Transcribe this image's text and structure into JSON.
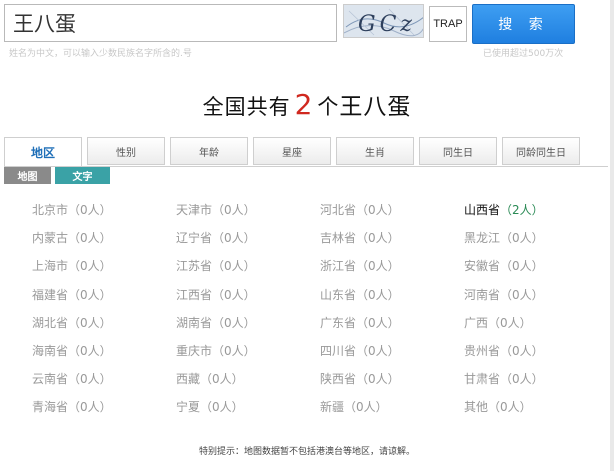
{
  "search": {
    "value": "王八蛋",
    "captcha_text": "GCz",
    "trap_label": "TRAP",
    "button_label": "搜 索"
  },
  "hints": {
    "left": "姓名为中文，可以输入少数民族名字所含的.号",
    "right": "已使用超过500万次"
  },
  "headline": {
    "prefix": "全国共有",
    "count": "2",
    "measure": "个",
    "name": "王八蛋"
  },
  "tabs": [
    {
      "label": "地区",
      "active": true
    },
    {
      "label": "性别"
    },
    {
      "label": "年龄"
    },
    {
      "label": "星座"
    },
    {
      "label": "生肖"
    },
    {
      "label": "同生日"
    },
    {
      "label": "同龄同生日"
    }
  ],
  "view_toggle": {
    "map": "地图",
    "text": "文字"
  },
  "regions": [
    [
      {
        "name": "北京市",
        "count": "（0人）"
      },
      {
        "name": "天津市",
        "count": "（0人）"
      },
      {
        "name": "河北省",
        "count": "（0人）"
      },
      {
        "name": "山西省",
        "count": "（2人）",
        "highlight": true
      }
    ],
    [
      {
        "name": "内蒙古",
        "count": "（0人）"
      },
      {
        "name": "辽宁省",
        "count": "（0人）"
      },
      {
        "name": "吉林省",
        "count": "（0人）"
      },
      {
        "name": "黑龙江",
        "count": "（0人）"
      }
    ],
    [
      {
        "name": "上海市",
        "count": "（0人）"
      },
      {
        "name": "江苏省",
        "count": "（0人）"
      },
      {
        "name": "浙江省",
        "count": "（0人）"
      },
      {
        "name": "安徽省",
        "count": "（0人）"
      }
    ],
    [
      {
        "name": "福建省",
        "count": "（0人）"
      },
      {
        "name": "江西省",
        "count": "（0人）"
      },
      {
        "name": "山东省",
        "count": "（0人）"
      },
      {
        "name": "河南省",
        "count": "（0人）"
      }
    ],
    [
      {
        "name": "湖北省",
        "count": "（0人）"
      },
      {
        "name": "湖南省",
        "count": "（0人）"
      },
      {
        "name": "广东省",
        "count": "（0人）"
      },
      {
        "name": "广西",
        "count": "（0人）"
      }
    ],
    [
      {
        "name": "海南省",
        "count": "（0人）"
      },
      {
        "name": "重庆市",
        "count": "（0人）"
      },
      {
        "name": "四川省",
        "count": "（0人）"
      },
      {
        "name": "贵州省",
        "count": "（0人）"
      }
    ],
    [
      {
        "name": "云南省",
        "count": "（0人）"
      },
      {
        "name": "西藏",
        "count": "（0人）"
      },
      {
        "name": "陕西省",
        "count": "（0人）"
      },
      {
        "name": "甘肃省",
        "count": "（0人）"
      }
    ],
    [
      {
        "name": "青海省",
        "count": "（0人）"
      },
      {
        "name": "宁夏",
        "count": "（0人）"
      },
      {
        "name": "新疆",
        "count": "（0人）"
      },
      {
        "name": "其他",
        "count": "（0人）"
      }
    ]
  ],
  "footer": "特别提示：地图数据暂不包括港澳台等地区，请谅解。",
  "colors": {
    "accent": "#1f7fe0",
    "count_highlight": "#d0281f",
    "hit_count": "#2a8a55",
    "text_tab": "#3aa2a6"
  }
}
